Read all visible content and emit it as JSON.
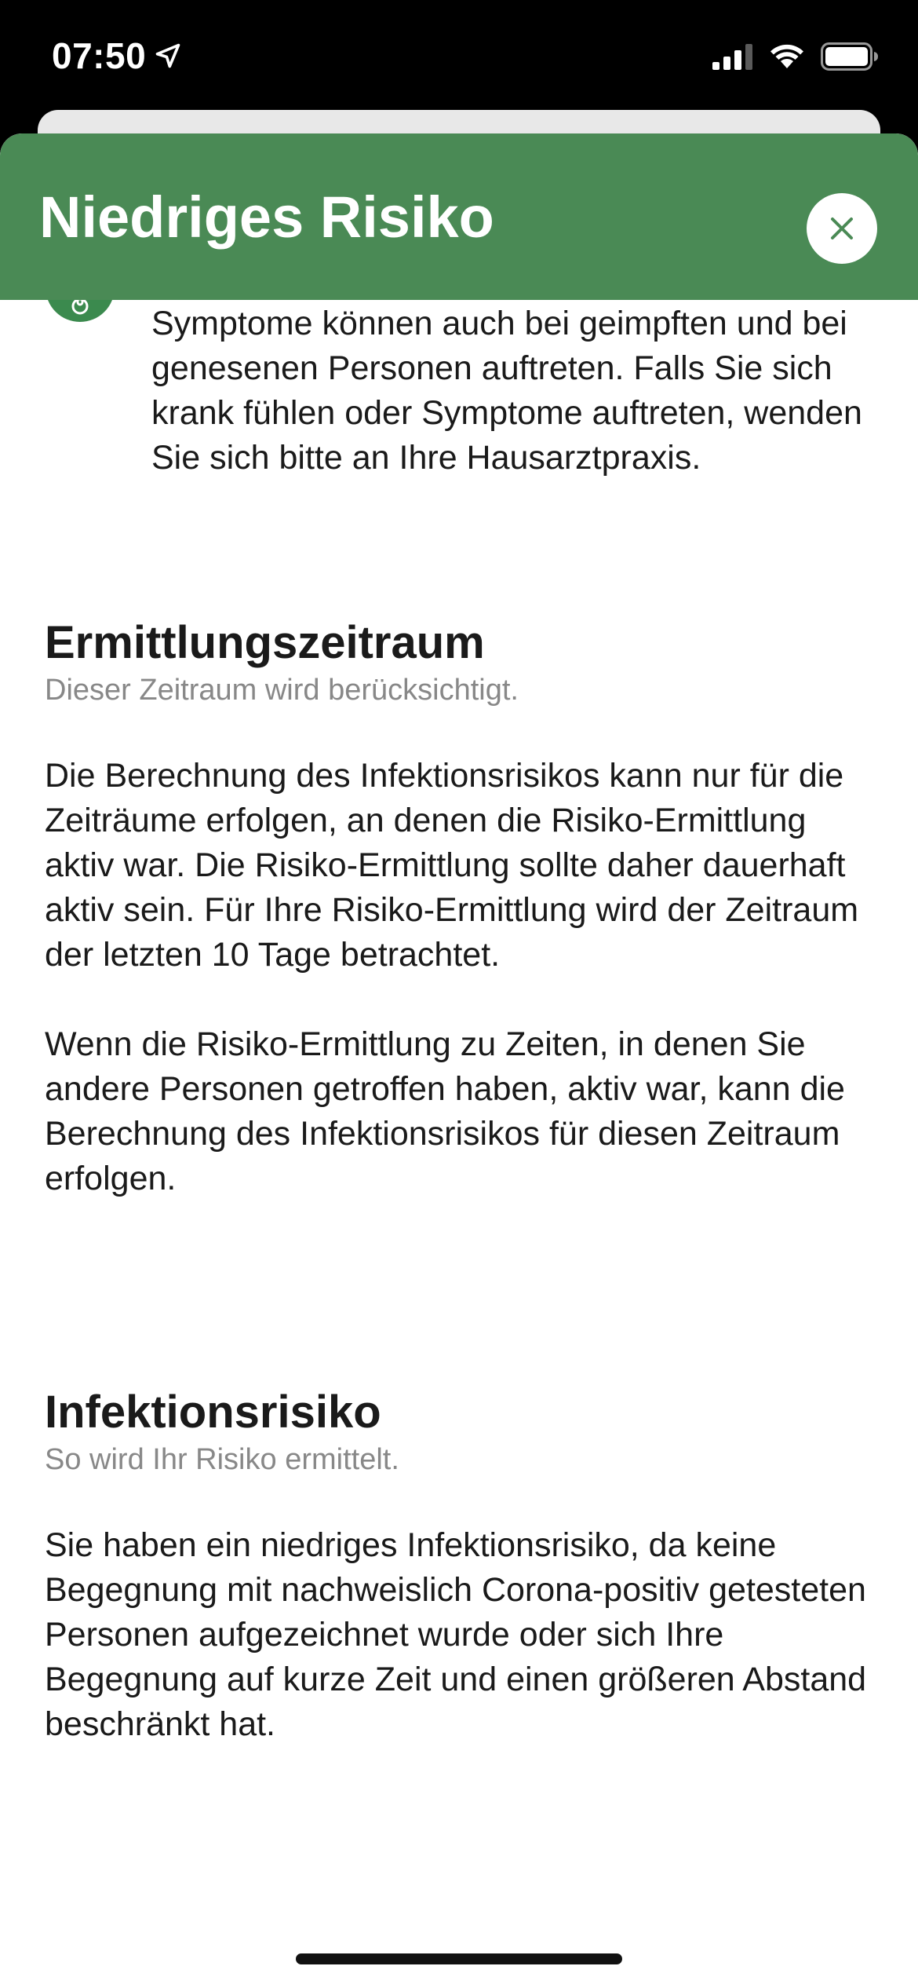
{
  "status_bar": {
    "time": "07:50",
    "location_icon": "location-arrow-icon",
    "signal_icon": "cellular-signal-icon",
    "wifi_icon": "wifi-icon",
    "battery_icon": "battery-icon"
  },
  "header": {
    "title": "Niedriges Risiko",
    "close_icon": "close-icon",
    "background_color": "#4a8a55"
  },
  "symptoms": {
    "icon": "thermometer-icon",
    "text": "Symptome können auch bei geimpften und bei genesenen Personen auftreten. Falls Sie sich krank fühlen oder Symptome auftreten, wenden Sie sich bitte an Ihre Hausarztpraxis."
  },
  "sections": [
    {
      "title": "Ermittlungszeitraum",
      "subtitle": "Dieser Zeitraum wird berücksichtigt.",
      "paragraphs": [
        "Die Berechnung des Infektionsrisikos kann nur für die Zeiträume erfolgen, an denen die Risiko-Ermittlung aktiv war. Die Risiko-Ermittlung sollte daher dauerhaft aktiv sein. Für Ihre Risiko-Ermittlung wird der Zeitraum der letzten 10 Tage betrachtet.",
        "Wenn die Risiko-Ermittlung zu Zeiten, in denen Sie andere Personen getroffen haben, aktiv war, kann die Berechnung des Infektionsrisikos für diesen Zeitraum erfolgen."
      ]
    },
    {
      "title": "Infektionsrisiko",
      "subtitle": "So wird Ihr Risiko ermittelt.",
      "paragraphs": [
        "Sie haben ein niedriges Infektionsrisiko, da keine Begegnung mit nachweislich Corona-positiv getesteten Personen aufgezeichnet wurde oder sich Ihre Begegnung auf kurze Zeit und einen größeren Abstand beschränkt hat."
      ]
    }
  ]
}
